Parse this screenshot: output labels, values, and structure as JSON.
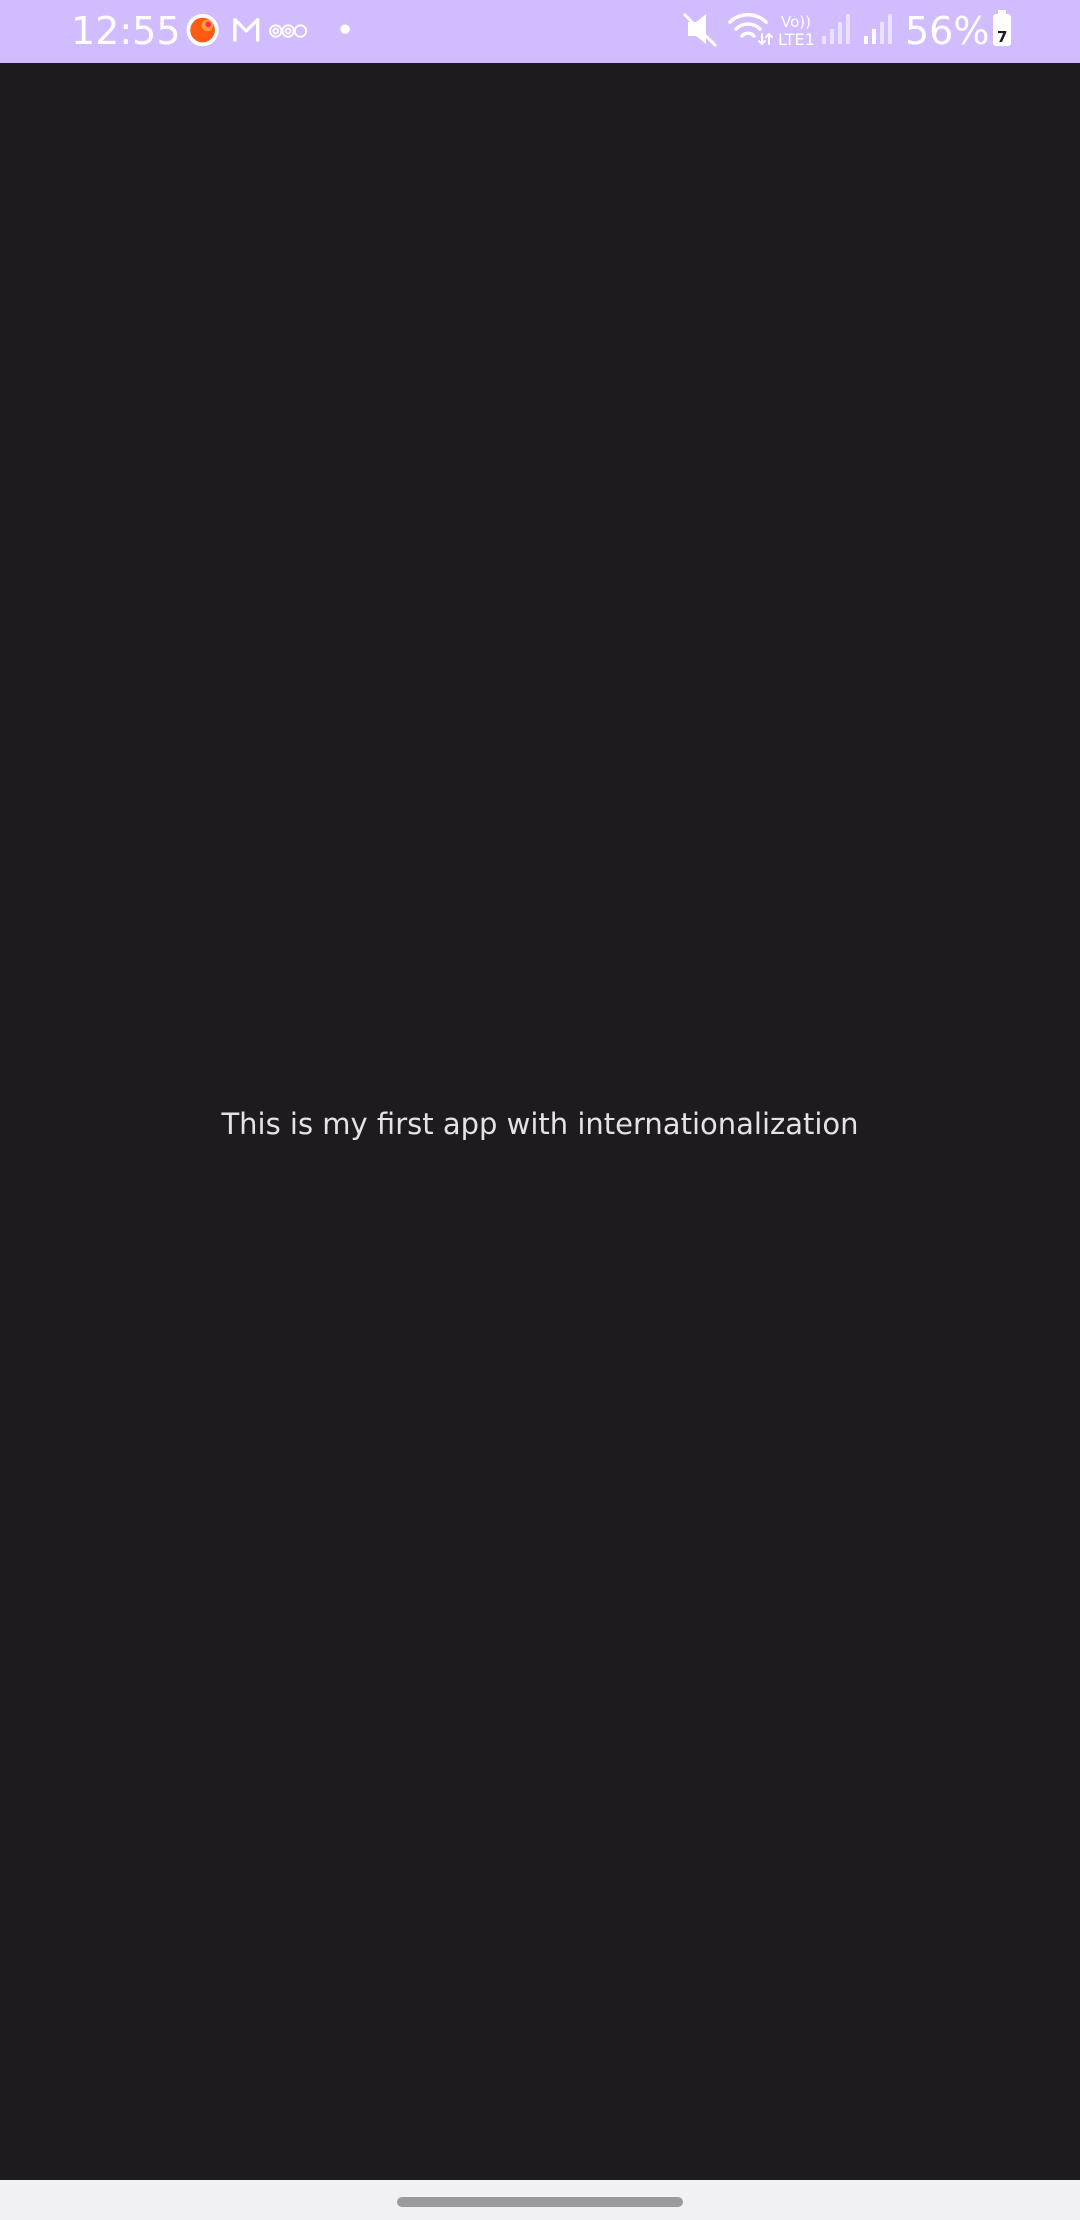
{
  "status_bar": {
    "time": "12:55",
    "notification_icons": [
      "app-circle-icon",
      "gmail-icon",
      "at-sign-icon",
      "dot-icon"
    ],
    "system_icons": [
      "mute-icon",
      "wifi-icon",
      "volte-lte-icon",
      "signal-icon",
      "signal-icon",
      "battery-icon"
    ],
    "volte_label": "Vo))",
    "lte_label": "LTE1",
    "battery_percent": "56%",
    "battery_badge": "7",
    "background_color": "#d0bcff"
  },
  "main": {
    "message": "This is my first app with internationalization",
    "background_color": "#1d1b20",
    "text_color": "#e6e0e9"
  },
  "nav_bar": {
    "background_color": "#f1f0f2",
    "handle_color": "#9b9a9c"
  }
}
